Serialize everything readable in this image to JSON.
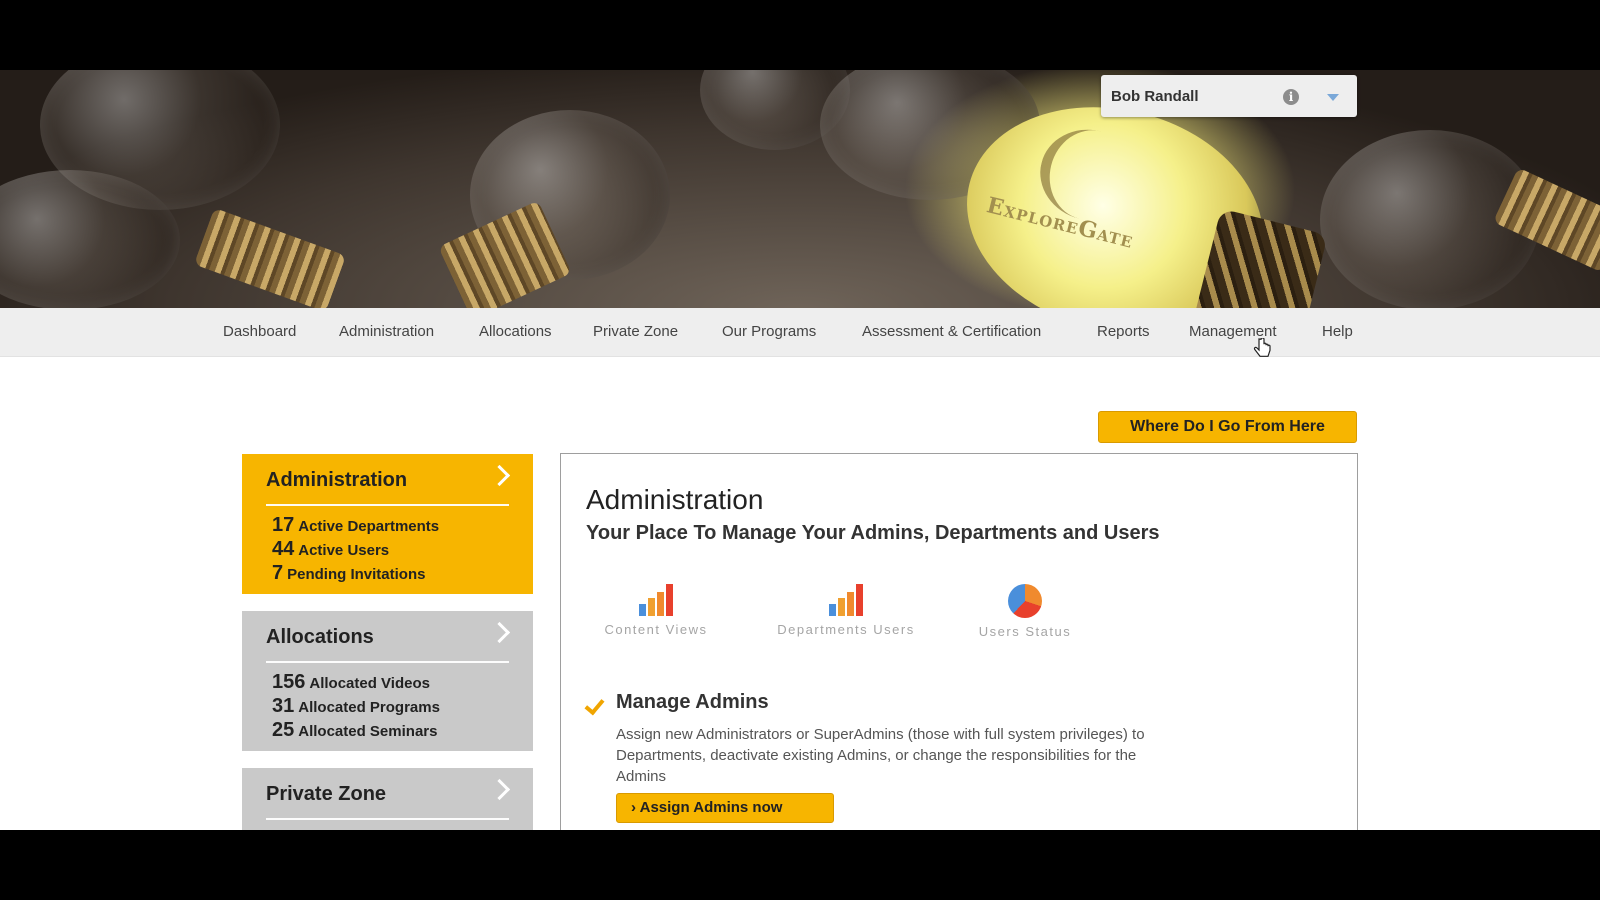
{
  "hero": {
    "brand_text": "ExploreGate"
  },
  "user": {
    "name": "Bob Randall"
  },
  "nav": {
    "items": [
      "Dashboard",
      "Administration",
      "Allocations",
      "Private Zone",
      "Our Programs",
      "Assessment & Certification",
      "Reports",
      "Management",
      "Help"
    ]
  },
  "cta": {
    "label": "Where Do I Go From Here"
  },
  "panels": [
    {
      "title": "Administration",
      "stats": [
        {
          "num": "17",
          "label": "Active Departments"
        },
        {
          "num": "44",
          "label": "Active Users"
        },
        {
          "num": "7",
          "label": "Pending Invitations"
        }
      ]
    },
    {
      "title": "Allocations",
      "stats": [
        {
          "num": "156",
          "label": "Allocated Videos"
        },
        {
          "num": "31",
          "label": "Allocated Programs"
        },
        {
          "num": "25",
          "label": "Allocated Seminars"
        }
      ]
    },
    {
      "title": "Private Zone",
      "stats": []
    }
  ],
  "main": {
    "title": "Administration",
    "subtitle": "Your Place To Manage Your Admins, Departments and Users",
    "widgets": [
      {
        "label": "Content Views",
        "icon": "bar-chart-icon"
      },
      {
        "label": "Departments Users",
        "icon": "bar-chart-icon"
      },
      {
        "label": "Users Status",
        "icon": "pie-chart-icon"
      }
    ],
    "section": {
      "title": "Manage Admins",
      "description": "Assign new Administrators or SuperAdmins (those with full system privileges) to Departments, deactivate existing Admins, or change the responsibilities for the Admins",
      "button": "Assign Admins now"
    }
  },
  "colors": {
    "accent": "#f7b500",
    "panel_grey": "#c9c9c9",
    "nav_bg": "#eeeeee"
  }
}
